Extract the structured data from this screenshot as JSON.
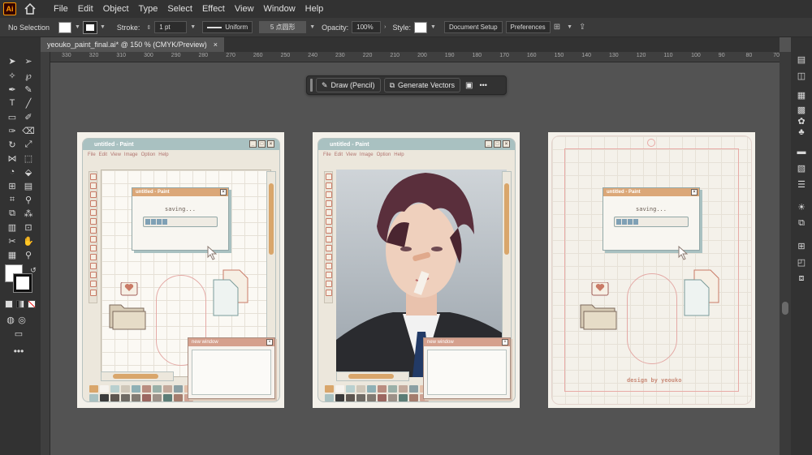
{
  "app": {
    "logo_text": "Ai"
  },
  "menu": [
    "File",
    "Edit",
    "Object",
    "Type",
    "Select",
    "Effect",
    "View",
    "Window",
    "Help"
  ],
  "control_bar": {
    "selection": "No Selection",
    "stroke_label": "Stroke:",
    "stroke_value": "1 pt",
    "stroke_profile": "Uniform",
    "brush": "5 点圆形",
    "opacity_label": "Opacity:",
    "opacity_value": "100%",
    "style_label": "Style:",
    "doc_setup": "Document Setup",
    "preferences": "Preferences"
  },
  "document_tab": {
    "title": "yeouko_paint_final.ai* @ 150 % (CMYK/Preview)",
    "close": "×"
  },
  "ruler_ticks": [
    "330",
    "320",
    "310",
    "300",
    "290",
    "280",
    "270",
    "260",
    "250",
    "240",
    "230",
    "220",
    "210",
    "200",
    "190",
    "180",
    "170",
    "160",
    "150",
    "140",
    "130",
    "120",
    "110",
    "100",
    "90",
    "80",
    "70"
  ],
  "context_bar": {
    "draw_label": "Draw (Pencil)",
    "generate_label": "Generate Vectors",
    "more": "•••"
  },
  "paint_window": {
    "title": "untitled - Paint",
    "menu": [
      "File",
      "Edit",
      "View",
      "Image",
      "Option",
      "Help"
    ],
    "dialog_title": "untitled - Paint",
    "saving": "saving...",
    "new_window": "new window",
    "progress_fraction": 0.35
  },
  "artboard3": {
    "credit": "design by yeouko"
  },
  "palette": [
    "#d9a66b",
    "#f6f3ee",
    "#b9d0cf",
    "#cfc7b9",
    "#8fb0b5",
    "#b98d80",
    "#9ab0a8",
    "#c2a99b",
    "#8b9fa3",
    "#e3c0aa",
    "#a9c1c1",
    "#3b3b3b",
    "#5d5650",
    "#6e6a64",
    "#817a72",
    "#9b6660",
    "#9c9188",
    "#5c7d76",
    "#a47c6d",
    "#cfa394"
  ],
  "colors": {
    "accent_orange": "#d9a66b",
    "title_teal": "#a9c1c1",
    "menu_rose": "#b0736e",
    "ui_dark": "#323232",
    "canvas_bg": "#535353"
  }
}
